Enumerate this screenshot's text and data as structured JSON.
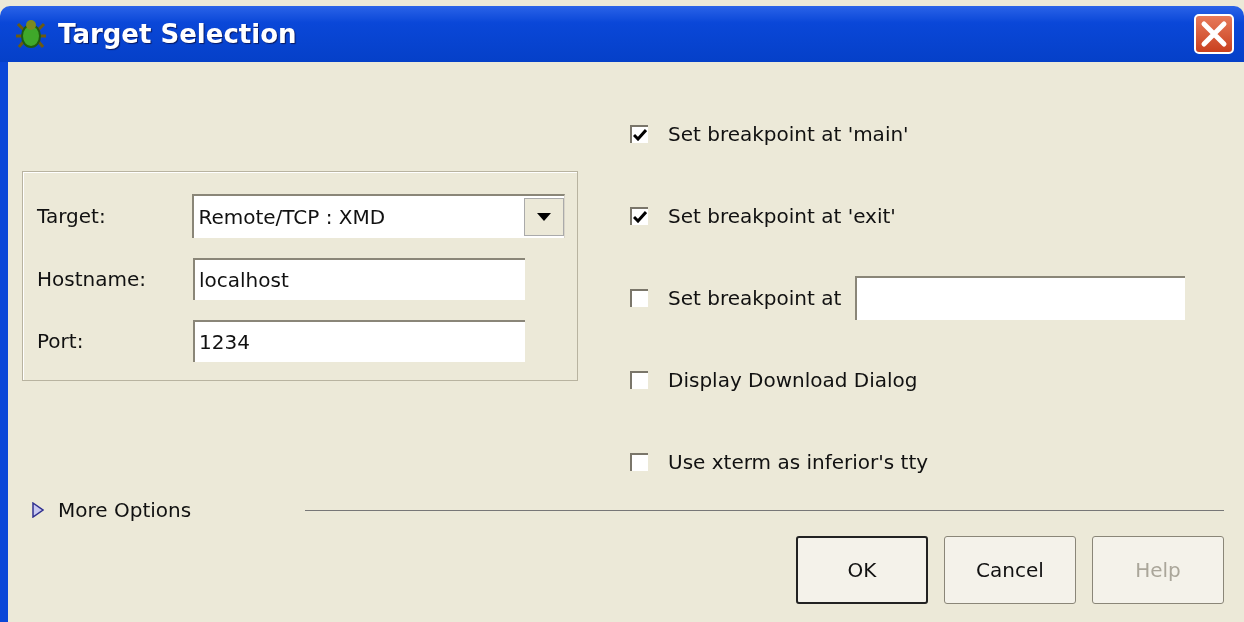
{
  "window": {
    "title": "Target Selection"
  },
  "target_group": {
    "fields": [
      {
        "kind": "dropdown",
        "label": "Target:",
        "value": "Remote/TCP : XMD"
      },
      {
        "kind": "text",
        "label": "Hostname:",
        "value": "localhost"
      },
      {
        "kind": "text",
        "label": "Port:",
        "value": "1234"
      }
    ]
  },
  "options": [
    {
      "kind": "checkbox",
      "label": "Set breakpoint at 'main'",
      "checked": true
    },
    {
      "kind": "checkbox",
      "label": "Set breakpoint at 'exit'",
      "checked": true
    },
    {
      "kind": "checkbox-input",
      "label": "Set breakpoint at",
      "checked": false
    },
    {
      "kind": "checkbox",
      "label": "Display Download Dialog",
      "checked": false
    },
    {
      "kind": "checkbox",
      "label": "Use xterm as inferior's tty",
      "checked": false
    }
  ],
  "more_options": {
    "label": "More Options",
    "expanded": false
  },
  "buttons": [
    {
      "label": "OK",
      "default": true,
      "disabled": false
    },
    {
      "label": "Cancel",
      "default": false,
      "disabled": false
    },
    {
      "label": "Help",
      "default": false,
      "disabled": true
    }
  ]
}
